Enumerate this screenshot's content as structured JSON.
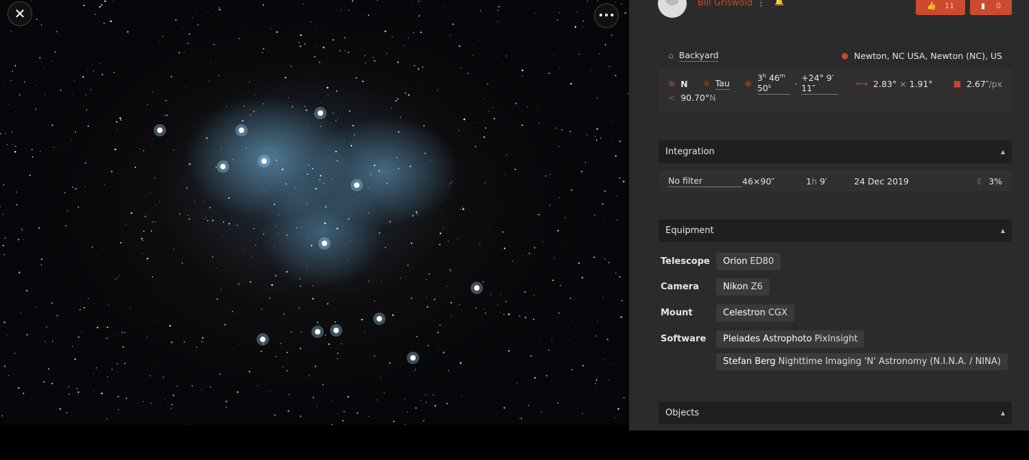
{
  "viewer": {
    "close_icon": "close-icon",
    "more_icon": "more-horizontal-icon"
  },
  "user": {
    "name": "Bill Griswold"
  },
  "actions": {
    "likes": "11",
    "bookmarks": "0"
  },
  "colors": {
    "accent": "#cc4a2f",
    "panel": "#2b2b2b"
  },
  "location": {
    "site": "Backyard",
    "place": "Newton, NC USA, Newton (NC), US"
  },
  "astrometry": {
    "orientation": "N",
    "constellation": "Tau",
    "ra_h": "3",
    "ra_m": "46",
    "ra_s": "50",
    "dec": "+24° 9′ 11″",
    "fov_w": "2.83°",
    "fov_sep": "×",
    "fov_h": "1.91°",
    "scale": "2.67″",
    "scale_unit": "/px",
    "rotation": "90.70°",
    "rotation_unit": "N"
  },
  "integration": {
    "title": "Integration",
    "filter": "No filter",
    "frames": "46×90″",
    "total_h": "1",
    "total_h_unit": "h",
    "total_m": "9′",
    "date": "24 Dec 2019",
    "moon": "3%"
  },
  "equipment": {
    "title": "Equipment",
    "rows": [
      {
        "label": "Telescope",
        "items": [
          {
            "brand": "Orion",
            "name": "ED80"
          }
        ]
      },
      {
        "label": "Camera",
        "items": [
          {
            "brand": "Nikon",
            "name": "Z6"
          }
        ]
      },
      {
        "label": "Mount",
        "items": [
          {
            "brand": "Celestron",
            "name": "CGX"
          }
        ]
      },
      {
        "label": "Software",
        "items": [
          {
            "brand": "Pleiades Astrophoto",
            "name": "PixInsight"
          },
          {
            "brand": "Stefan Berg",
            "name": "Nighttime Imaging 'N' Astronomy (N.I.N.A. / NINA)"
          }
        ]
      }
    ]
  },
  "objects": {
    "title": "Objects"
  }
}
